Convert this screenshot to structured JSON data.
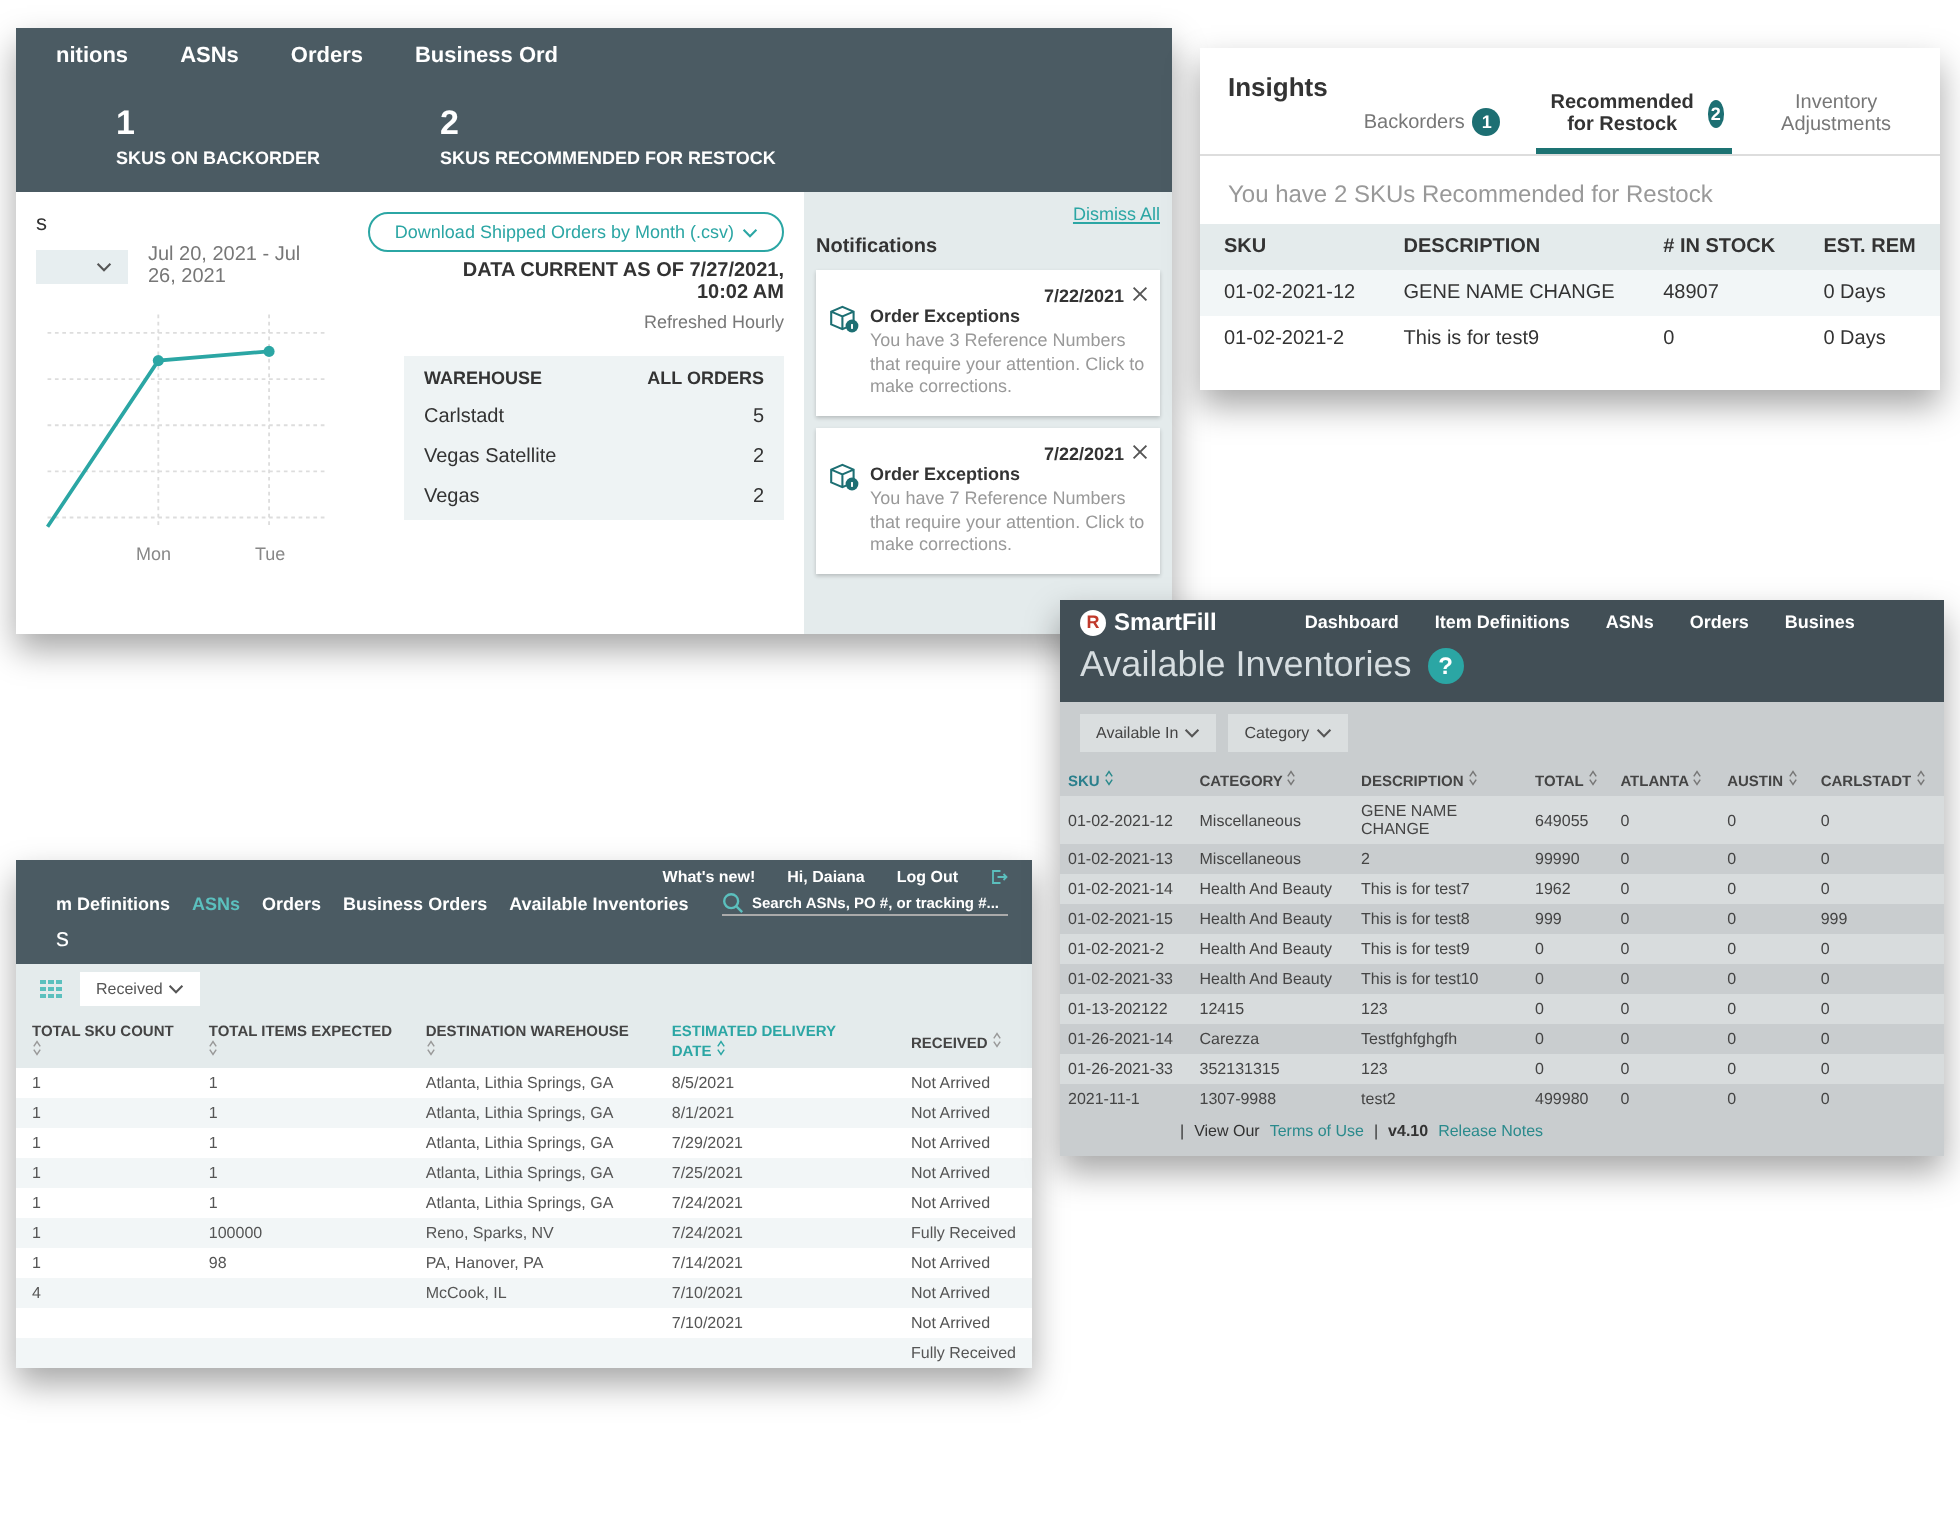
{
  "dashboard": {
    "nav": [
      "nitions",
      "ASNs",
      "Orders",
      "Business Ord"
    ],
    "stats": [
      {
        "value": "1",
        "label": "SKUS ON BACKORDER"
      },
      {
        "value": "2",
        "label": "SKUS RECOMMENDED FOR RESTOCK"
      }
    ],
    "chart_title": "s",
    "date_range": "Jul 20, 2021 - Jul 26, 2021",
    "chart": {
      "x_labels": [
        "Mon",
        "Tue"
      ]
    },
    "download_button": "Download Shipped Orders by Month (.csv)",
    "data_current": "DATA CURRENT AS OF 7/27/2021, 10:02 AM",
    "refreshed": "Refreshed Hourly",
    "warehouse_table": {
      "columns": [
        "WAREHOUSE",
        "ALL ORDERS"
      ],
      "rows": [
        [
          "Carlstadt",
          "5"
        ],
        [
          "Vegas Satellite",
          "2"
        ],
        [
          "Vegas",
          "2"
        ]
      ]
    },
    "notifications": {
      "title": "Notifications",
      "dismiss": "Dismiss All",
      "items": [
        {
          "title": "Order Exceptions",
          "date": "7/22/2021",
          "body": "You have 3 Reference Numbers that require your attention. Click to make corrections."
        },
        {
          "title": "Order Exceptions",
          "date": "7/22/2021",
          "body": "You have 7 Reference Numbers that require your attention. Click to make corrections."
        }
      ]
    }
  },
  "insights": {
    "title": "Insights",
    "tabs": [
      {
        "label": "Backorders",
        "count": "1",
        "selected": false
      },
      {
        "label": "Recommended for Restock",
        "count": "2",
        "selected": true
      },
      {
        "label": "Inventory Adjustments",
        "selected": false
      }
    ],
    "summary": "You have 2 SKUs Recommended for Restock",
    "table": {
      "columns": [
        "SKU",
        "DESCRIPTION",
        "# IN STOCK",
        "EST. REM"
      ],
      "rows": [
        [
          "01-02-2021-12",
          "GENE NAME CHANGE",
          "48907",
          "0 Days"
        ],
        [
          "01-02-2021-2",
          "This is for test9",
          "0",
          "0 Days"
        ]
      ]
    }
  },
  "asns": {
    "nav": [
      {
        "label": "m Definitions",
        "selected": false
      },
      {
        "label": "ASNs",
        "selected": true
      },
      {
        "label": "Orders",
        "selected": false
      },
      {
        "label": "Business Orders",
        "selected": false
      },
      {
        "label": "Available Inventories",
        "selected": false
      }
    ],
    "links": [
      "What's new!",
      "Hi, Daiana",
      "Log Out"
    ],
    "search": {
      "placeholder": "Search ASNs, PO #, or tracking #..."
    },
    "heading": "s",
    "filter": "Received",
    "table": {
      "columns": [
        {
          "label": "TOTAL SKU COUNT",
          "sorted": false
        },
        {
          "label": "TOTAL ITEMS EXPECTED",
          "sorted": false
        },
        {
          "label": "DESTINATION WAREHOUSE",
          "sorted": false
        },
        {
          "label": "ESTIMATED DELIVERY DATE",
          "sorted": true
        },
        {
          "label": "RECEIVED",
          "sorted": false
        }
      ],
      "rows": [
        [
          "1",
          "1",
          "Atlanta, Lithia Springs, GA",
          "8/5/2021",
          "Not Arrived"
        ],
        [
          "1",
          "1",
          "Atlanta, Lithia Springs, GA",
          "8/1/2021",
          "Not Arrived"
        ],
        [
          "1",
          "1",
          "Atlanta, Lithia Springs, GA",
          "7/29/2021",
          "Not Arrived"
        ],
        [
          "1",
          "1",
          "Atlanta, Lithia Springs, GA",
          "7/25/2021",
          "Not Arrived"
        ],
        [
          "1",
          "1",
          "Atlanta, Lithia Springs, GA",
          "7/24/2021",
          "Not Arrived"
        ],
        [
          "1",
          "100000",
          "Reno, Sparks, NV",
          "7/24/2021",
          "Fully Received"
        ],
        [
          "1",
          "98",
          "PA, Hanover, PA",
          "7/14/2021",
          "Not Arrived"
        ],
        [
          "4",
          null,
          "McCook, IL",
          "7/10/2021",
          "Not Arrived"
        ],
        [
          null,
          null,
          null,
          "7/10/2021",
          "Not Arrived"
        ],
        [
          null,
          null,
          null,
          null,
          "Fully Received"
        ]
      ]
    }
  },
  "inventory": {
    "logo": {
      "mark": "R",
      "name": "SmartFill"
    },
    "nav": [
      "Dashboard",
      "Item Definitions",
      "ASNs",
      "Orders",
      "Busines"
    ],
    "title": "Available Inventories",
    "help": "?",
    "filters": [
      "Available In",
      "Category"
    ],
    "table": {
      "columns": [
        {
          "label": "SKU",
          "sorted": true
        },
        {
          "label": "CATEGORY",
          "sorted": false
        },
        {
          "label": "DESCRIPTION",
          "sorted": false
        },
        {
          "label": "TOTAL",
          "sorted": false
        },
        {
          "label": "ATLANTA",
          "sorted": false
        },
        {
          "label": "AUSTIN",
          "sorted": false
        },
        {
          "label": "CARLSTADT",
          "sorted": false
        }
      ],
      "rows": [
        [
          "01-02-2021-12",
          "Miscellaneous",
          "GENE NAME CHANGE",
          "649055",
          "0",
          "0",
          "0"
        ],
        [
          "01-02-2021-13",
          "Miscellaneous",
          "2",
          "99990",
          "0",
          "0",
          "0"
        ],
        [
          "01-02-2021-14",
          "Health And Beauty",
          "This is for test7",
          "1962",
          "0",
          "0",
          "0"
        ],
        [
          "01-02-2021-15",
          "Health And Beauty",
          "This is for test8",
          "999",
          "0",
          "0",
          "999"
        ],
        [
          "01-02-2021-2",
          "Health And Beauty",
          "This is for test9",
          "0",
          "0",
          "0",
          "0"
        ],
        [
          "01-02-2021-33",
          "Health And Beauty",
          "This is for test10",
          "0",
          "0",
          "0",
          "0"
        ],
        [
          "01-13-202122",
          "12415",
          "123",
          "0",
          "0",
          "0",
          "0"
        ],
        [
          "01-26-2021-14",
          "Carezza",
          "Testfghfghgfh",
          "0",
          "0",
          "0",
          "0"
        ],
        [
          "01-26-2021-33",
          "352131315",
          "123",
          "0",
          "0",
          "0",
          "0"
        ],
        [
          "2021-11-1",
          "1307-9988",
          "test2",
          "499980",
          "0",
          "0",
          "0"
        ]
      ]
    },
    "footer": [
      {
        "kind": "separator",
        "text": "|"
      },
      {
        "kind": "text",
        "text": "View Our"
      },
      {
        "kind": "link",
        "text": "Terms of Use"
      },
      {
        "kind": "separator",
        "text": "|"
      },
      {
        "kind": "version",
        "text": "v4.10"
      },
      {
        "kind": "link",
        "text": "Release Notes"
      }
    ]
  }
}
